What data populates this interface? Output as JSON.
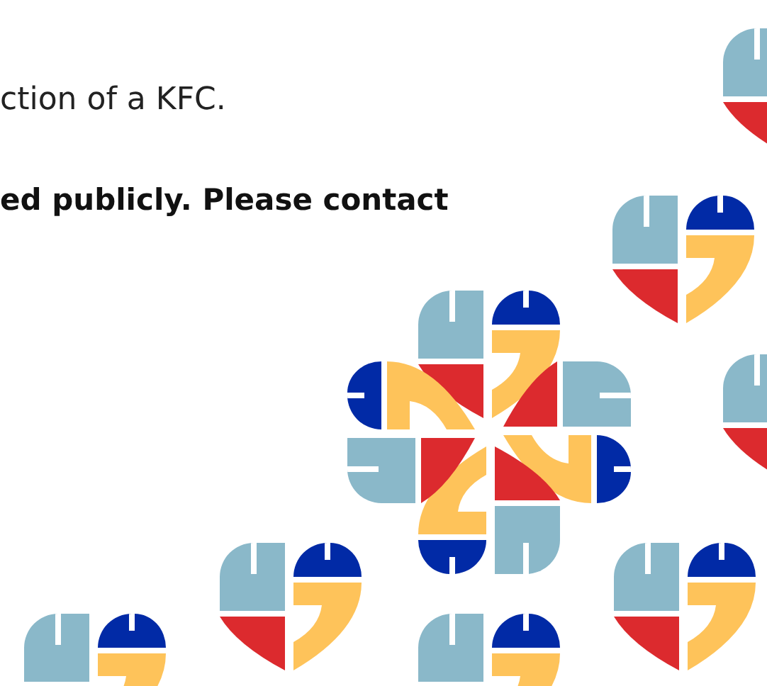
{
  "paragraphs": [
    {
      "text": "ction of a KFC.",
      "kind": "normal"
    },
    {
      "text": "ed publicly. Please contact",
      "kind": "bold"
    }
  ]
}
